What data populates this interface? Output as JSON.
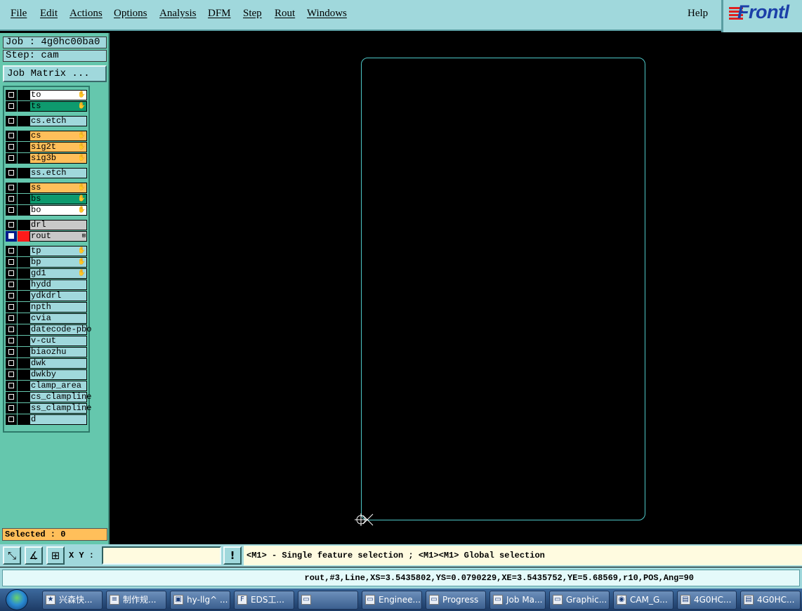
{
  "menu": [
    {
      "label": "File"
    },
    {
      "label": "Edit"
    },
    {
      "label": "Actions"
    },
    {
      "label": "Options"
    },
    {
      "label": "Analysis"
    },
    {
      "label": "DFM"
    },
    {
      "label": "Step"
    },
    {
      "label": "Rout"
    },
    {
      "label": "Windows"
    },
    {
      "label": "Help"
    }
  ],
  "logo_text": "Frontl",
  "job_label": "Job : 4g0hc00ba0",
  "step_label": "Step: cam",
  "job_matrix_button": "Job Matrix ...",
  "layers": [
    {
      "name": "to",
      "color": "white",
      "icon": "✋"
    },
    {
      "name": "ts",
      "color": "green",
      "icon": "✋"
    },
    {
      "name": "cs.etch",
      "color": "plain",
      "icon": ""
    },
    {
      "name": "cs",
      "color": "orange",
      "icon": "✋"
    },
    {
      "name": "sig2t",
      "color": "orange",
      "icon": "✋"
    },
    {
      "name": "sig3b",
      "color": "orange",
      "icon": "✋"
    },
    {
      "name": "ss.etch",
      "color": "plain",
      "icon": ""
    },
    {
      "name": "ss",
      "color": "orange",
      "icon": "✋"
    },
    {
      "name": "bs",
      "color": "green",
      "icon": "✋"
    },
    {
      "name": "bo",
      "color": "white",
      "icon": "✋"
    },
    {
      "name": "drl",
      "color": "gray",
      "icon": ""
    },
    {
      "name": "rout",
      "color": "gray",
      "icon": "⊞"
    },
    {
      "name": "tp",
      "color": "plain",
      "icon": "✋"
    },
    {
      "name": "bp",
      "color": "plain",
      "icon": "✋"
    },
    {
      "name": "gd1",
      "color": "plain",
      "icon": "✋"
    },
    {
      "name": "hydd",
      "color": "plain",
      "icon": ""
    },
    {
      "name": "ydkdrl",
      "color": "plain",
      "icon": ""
    },
    {
      "name": "npth",
      "color": "plain",
      "icon": ""
    },
    {
      "name": "cvia",
      "color": "plain",
      "icon": ""
    },
    {
      "name": "datecode-pbo",
      "color": "plain",
      "icon": ""
    },
    {
      "name": "v-cut",
      "color": "plain",
      "icon": ""
    },
    {
      "name": "biaozhu",
      "color": "plain",
      "icon": ""
    },
    {
      "name": "dwk",
      "color": "plain",
      "icon": ""
    },
    {
      "name": "dwkby",
      "color": "plain",
      "icon": ""
    },
    {
      "name": "clamp_area",
      "color": "plain",
      "icon": ""
    },
    {
      "name": "cs_clampline",
      "color": "plain",
      "icon": ""
    },
    {
      "name": "ss_clampline",
      "color": "plain",
      "icon": ""
    },
    {
      "name": "d",
      "color": "plain",
      "icon": ""
    }
  ],
  "selected_label": "Selected : 0",
  "xy_label": "X Y :",
  "xy_input_value": "",
  "hint": "<M1> - Single feature selection ; <M1><M1> Global selection",
  "status": "rout,#3,Line,XS=3.5435802,YS=0.0790229,XE=3.5435752,YE=5.68569,r10,POS,Ang=90",
  "colors": {
    "menu_bg": "#a0d8dc",
    "panel_bg": "#65c7ad",
    "outline": "#4ec8c8",
    "orange": "#ffbf5a",
    "green": "#0e9a6e"
  },
  "taskbar": [
    {
      "label": "兴森快...",
      "icon": "star-icon"
    },
    {
      "label": "制作规...",
      "icon": "document-icon"
    },
    {
      "label": "hy-llg^ ...",
      "icon": "save-icon"
    },
    {
      "label": "EDS工...",
      "icon": "f-icon"
    },
    {
      "label": "",
      "icon": "window-icon"
    },
    {
      "label": "Enginee...",
      "icon": "window-icon"
    },
    {
      "label": "Progress",
      "icon": "window-icon"
    },
    {
      "label": "Job Ma...",
      "icon": "window-icon"
    },
    {
      "label": "Graphic...",
      "icon": "window-icon"
    },
    {
      "label": "CAM_G...",
      "icon": "app-icon"
    },
    {
      "label": "4G0HC...",
      "icon": "file-icon"
    },
    {
      "label": "4G0HC...",
      "icon": "file-icon"
    }
  ]
}
